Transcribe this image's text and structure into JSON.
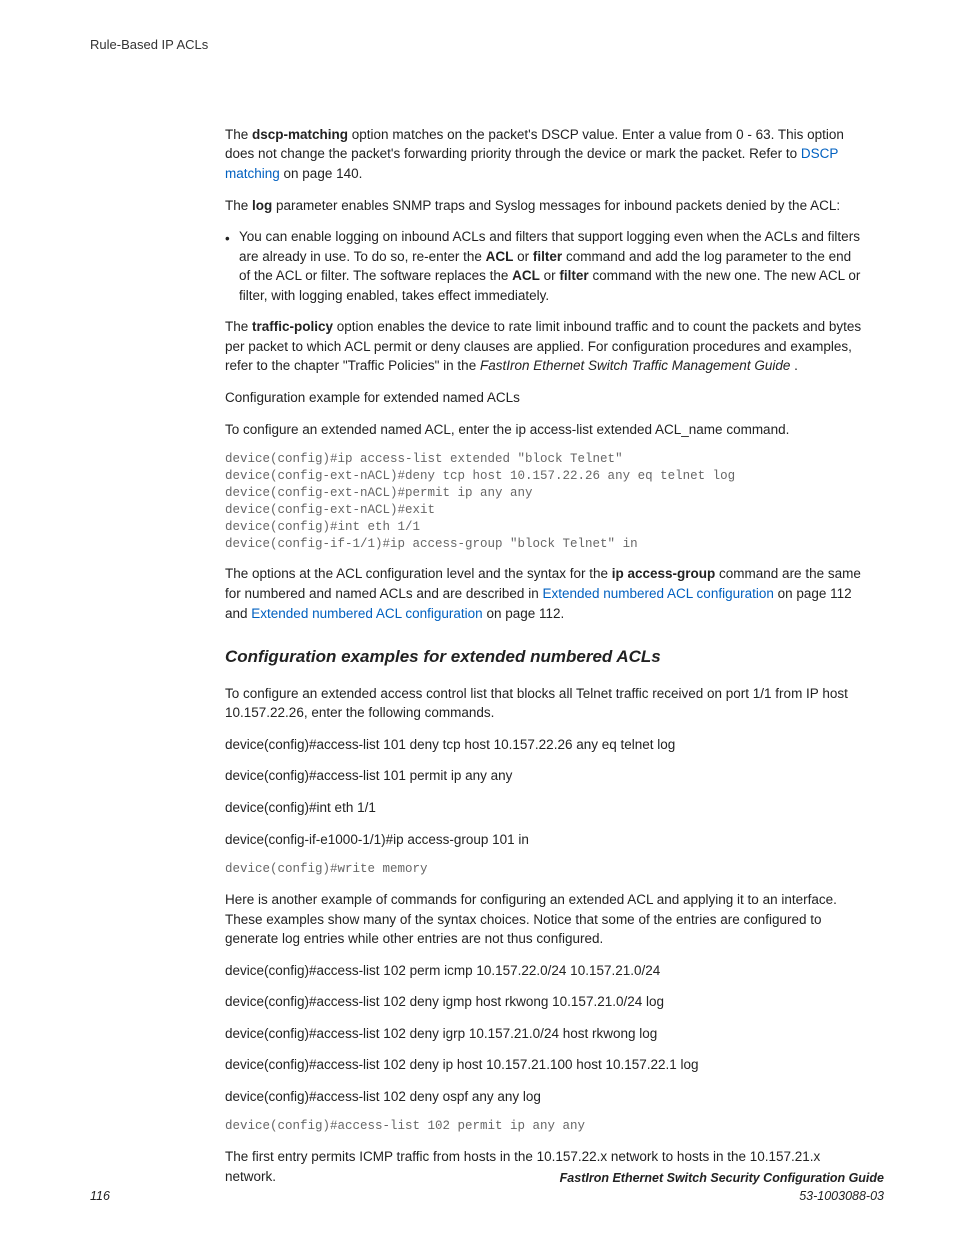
{
  "header": {
    "running": "Rule-Based IP ACLs"
  },
  "p1": {
    "t1": "The ",
    "b1": "dscp-matching",
    "t2": " option matches on the packet's DSCP value. Enter a value from 0 - 63. This option does not change the packet's forwarding priority through the device or mark the packet. Refer to ",
    "link1": "DSCP matching",
    "t3": " on page 140."
  },
  "p2": {
    "t1": "The ",
    "b1": "log",
    "t2": " parameter enables SNMP traps and Syslog messages for inbound packets denied by the ACL:"
  },
  "bullet1": {
    "t1": "You can enable logging on inbound ACLs and filters that support logging even when the ACLs and filters are already in use. To do so, re-enter the ",
    "b1": "ACL",
    "t2": " or ",
    "b2": "filter",
    "t3": " command and add the log parameter to the end of the ACL or filter. The software replaces the ",
    "b3": "ACL",
    "t4": " or ",
    "b4": "filter",
    "t5": " command with the new one. The new ACL or filter, with logging enabled, takes effect immediately."
  },
  "p3": {
    "t1": "The ",
    "b1": "traffic-policy",
    "t2": " option enables the device to rate limit inbound traffic and to count the packets and bytes per packet to which ACL permit or deny clauses are applied. For configuration procedures and examples, refer to the chapter \"Traffic Policies\" in the ",
    "i1": "FastIron Ethernet Switch Traffic Management Guide",
    "t3": " ."
  },
  "p4": "Configuration example for extended named ACLs",
  "p5": "To configure an extended named ACL, enter the ip access-list extended ACL_name command.",
  "code1": "device(config)#ip access-list extended \"block Telnet\"\ndevice(config-ext-nACL)#deny tcp host 10.157.22.26 any eq telnet log\ndevice(config-ext-nACL)#permit ip any any\ndevice(config-ext-nACL)#exit\ndevice(config)#int eth 1/1\ndevice(config-if-1/1)#ip access-group \"block Telnet\" in",
  "p6": {
    "t1": "The options at the ACL configuration level and the syntax for the ",
    "b1": "ip access-group",
    "t2": " command are the same for numbered and named ACLs and are described in ",
    "link1": "Extended numbered ACL configuration",
    "t3": " on page 112 and ",
    "link2": "Extended numbered ACL configuration",
    "t4": " on page 112."
  },
  "section1": "Configuration examples for extended numbered ACLs",
  "p7": "To configure an extended access control list that blocks all Telnet traffic received on port 1/1 from IP host 10.157.22.26, enter the following commands.",
  "p8": "device(config)#access-list 101 deny tcp host 10.157.22.26 any eq telnet log",
  "p9": "device(config)#access-list 101 permit ip any any",
  "p10": "device(config)#int eth 1/1",
  "p11": "device(config-if-e1000-1/1)#ip access-group 101 in",
  "code2": "device(config)#write memory",
  "p12": "Here is another example of commands for configuring an extended ACL and applying it to an interface. These examples show many of the syntax choices. Notice that some of the entries are configured to generate log entries while other entries are not thus configured.",
  "p13": "device(config)#access-list 102 perm icmp 10.157.22.0/24 10.157.21.0/24",
  "p14": "device(config)#access-list 102 deny igmp host rkwong 10.157.21.0/24 log",
  "p15": "device(config)#access-list 102 deny igrp 10.157.21.0/24 host rkwong log",
  "p16": "device(config)#access-list 102 deny ip host 10.157.21.100 host 10.157.22.1 log",
  "p17": "device(config)#access-list 102 deny ospf any any log",
  "code3": "device(config)#access-list 102 permit ip any any",
  "p18": "The first entry permits ICMP traffic from hosts in the 10.157.22.x network to hosts in the 10.157.21.x network.",
  "footer": {
    "page": "116",
    "title": "FastIron Ethernet Switch Security Configuration Guide",
    "docnum": "53-1003088-03"
  }
}
